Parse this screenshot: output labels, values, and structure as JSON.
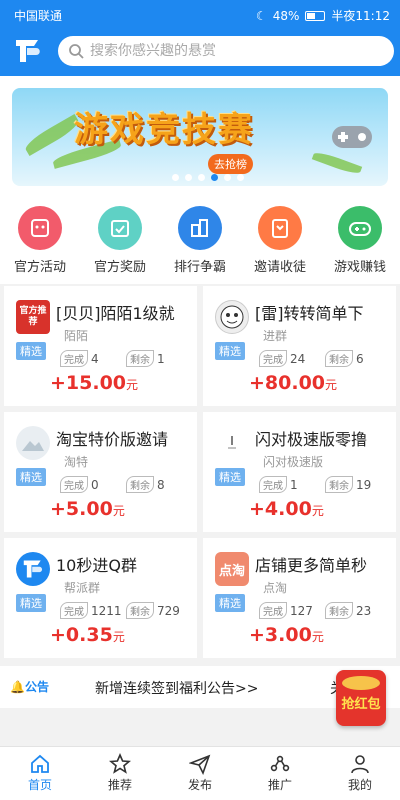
{
  "status_bar": {
    "carrier": "中国联通",
    "battery": "48%",
    "time": "半夜11:12"
  },
  "search": {
    "placeholder": "搜索你感兴趣的悬赏"
  },
  "banner": {
    "title": "游戏竞技赛",
    "badge": "去抢榜",
    "dot_count": 6,
    "active_dot": 4
  },
  "menu": {
    "items": [
      {
        "label": "官方活动",
        "icon": "activity-icon",
        "color": "#f25b6b"
      },
      {
        "label": "官方奖励",
        "icon": "reward-icon",
        "color": "#5fd1c5"
      },
      {
        "label": "排行争霸",
        "icon": "ranking-icon",
        "color": "#2f86e8"
      },
      {
        "label": "邀请收徒",
        "icon": "invite-icon",
        "color": "#ff7a45"
      },
      {
        "label": "游戏赚钱",
        "icon": "game-icon",
        "color": "#3bbd6a"
      }
    ]
  },
  "tasks": [
    {
      "title": "[贝贝]陌陌1级就",
      "sub": "陌陌",
      "tag": "精选",
      "done_label": "完成",
      "done": "4",
      "left_label": "剩余",
      "left": "1",
      "price": "+15.00",
      "unit": "元",
      "thumb": "官方推荐"
    },
    {
      "title": "[雷]转转简单下",
      "sub": "进群",
      "tag": "精选",
      "done_label": "完成",
      "done": "24",
      "left_label": "剩余",
      "left": "6",
      "price": "+80.00",
      "unit": "元",
      "thumb": ""
    },
    {
      "title": "淘宝特价版邀请",
      "sub": "淘特",
      "tag": "精选",
      "done_label": "完成",
      "done": "0",
      "left_label": "剩余",
      "left": "8",
      "price": "+5.00",
      "unit": "元",
      "thumb": ""
    },
    {
      "title": "闪对极速版零撸",
      "sub": "闪对极速版",
      "tag": "精选",
      "done_label": "完成",
      "done": "1",
      "left_label": "剩余",
      "left": "19",
      "price": "+4.00",
      "unit": "元",
      "thumb": ""
    },
    {
      "title": "10秒进Q群",
      "sub": "帮派群",
      "tag": "精选",
      "done_label": "完成",
      "done": "1211",
      "left_label": "剩余",
      "left": "729",
      "price": "+0.35",
      "unit": "元",
      "thumb": ""
    },
    {
      "title": "店铺更多简单秒",
      "sub": "点淘",
      "tag": "精选",
      "done_label": "完成",
      "done": "127",
      "left_label": "剩余",
      "left": "23",
      "price": "+3.00",
      "unit": "元",
      "thumb": "点淘"
    }
  ],
  "notice": {
    "label": "公告",
    "text": "新增连续签到福利公告>>",
    "text2": "关于"
  },
  "redpack": {
    "label": "抢红包"
  },
  "bottom_nav": [
    {
      "label": "首页",
      "icon": "home-icon",
      "active": true
    },
    {
      "label": "推荐",
      "icon": "star-icon",
      "active": false
    },
    {
      "label": "发布",
      "icon": "send-icon",
      "active": false
    },
    {
      "label": "推广",
      "icon": "share-icon",
      "active": false
    },
    {
      "label": "我的",
      "icon": "user-icon",
      "active": false
    }
  ],
  "colors": {
    "brand": "#1e88f0",
    "price": "#e8312c",
    "tag": "#6fb1ef"
  }
}
